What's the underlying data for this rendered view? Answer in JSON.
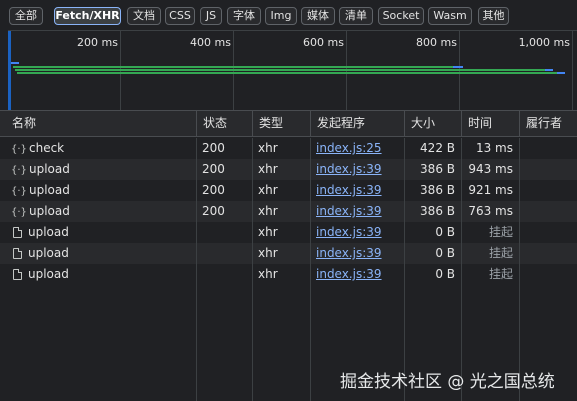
{
  "filters": [
    {
      "label": "全部",
      "active": false
    },
    {
      "label": "Fetch/XHR",
      "active": true
    },
    {
      "label": "文档",
      "active": false
    },
    {
      "label": "CSS",
      "active": false
    },
    {
      "label": "JS",
      "active": false
    },
    {
      "label": "字体",
      "active": false
    },
    {
      "label": "Img",
      "active": false
    },
    {
      "label": "媒体",
      "active": false
    },
    {
      "label": "清单",
      "active": false
    },
    {
      "label": "Socket",
      "active": false
    },
    {
      "label": "Wasm",
      "active": false
    },
    {
      "label": "其他",
      "active": false
    }
  ],
  "overview": {
    "ticks": [
      "200 ms",
      "400 ms",
      "600 ms",
      "800 ms",
      "1,000 ms"
    ],
    "bar_colors": {
      "waiting": "#34a853",
      "download": "#4285f4"
    }
  },
  "table": {
    "columns": [
      "名称",
      "状态",
      "类型",
      "发起程序",
      "大小",
      "时间",
      "履行者"
    ],
    "rows": [
      {
        "icon": "xhr-icon",
        "name": "check",
        "status": "200",
        "type": "xhr",
        "initiator": "index.js:25",
        "size": "422 B",
        "time": "13 ms"
      },
      {
        "icon": "xhr-icon",
        "name": "upload",
        "status": "200",
        "type": "xhr",
        "initiator": "index.js:39",
        "size": "386 B",
        "time": "943 ms"
      },
      {
        "icon": "xhr-icon",
        "name": "upload",
        "status": "200",
        "type": "xhr",
        "initiator": "index.js:39",
        "size": "386 B",
        "time": "921 ms"
      },
      {
        "icon": "xhr-icon",
        "name": "upload",
        "status": "200",
        "type": "xhr",
        "initiator": "index.js:39",
        "size": "386 B",
        "time": "763 ms"
      },
      {
        "icon": "document-icon",
        "name": "upload",
        "status": "",
        "type": "xhr",
        "initiator": "index.js:39",
        "size": "0 B",
        "time": "挂起"
      },
      {
        "icon": "document-icon",
        "name": "upload",
        "status": "",
        "type": "xhr",
        "initiator": "index.js:39",
        "size": "0 B",
        "time": "挂起"
      },
      {
        "icon": "document-icon",
        "name": "upload",
        "status": "",
        "type": "xhr",
        "initiator": "index.js:39",
        "size": "0 B",
        "time": "挂起"
      }
    ]
  },
  "watermark": "掘金技术社区 @ 光之国总统"
}
